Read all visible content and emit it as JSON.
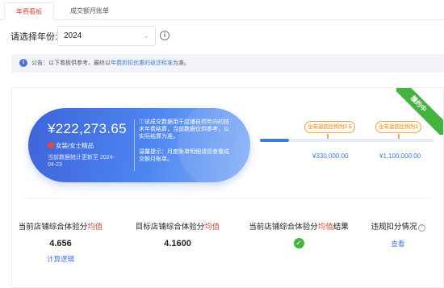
{
  "tabs": [
    {
      "label": "年费看板",
      "active": true
    },
    {
      "label": "成交额月账单",
      "active": false
    }
  ],
  "year_filter": {
    "label": "请选择年份:",
    "value": "2024"
  },
  "notice": {
    "prefix": "公告：以下看板供参考，最终以",
    "link": "年费折扣优惠的返还标准",
    "suffix": "为准。"
  },
  "status_ribbon": "履约中",
  "summary": {
    "amount": "¥222,273.65",
    "category": "女装/女士精品",
    "update_text": "当前数据统计更新至 2024-04-23",
    "explain": "该成交数据用于店铺自然年内的技术年费结算，当前数据仅供参考，以实际结算为准。",
    "tip": "温馨提示：月度账单明细请您查看成交额月账单。"
  },
  "progress": {
    "current": 222273.65,
    "max": 1100000,
    "milestones": [
      {
        "label": "全年返回比例为0.5",
        "value_text": "¥330,000.00"
      },
      {
        "label": "全年返回比例为1",
        "value_text": "¥1,100,000.00"
      }
    ]
  },
  "metrics": [
    {
      "title_prefix": "当前店铺综合体验分",
      "title_hl": "均值",
      "title_suffix": "",
      "value": "4.656",
      "link": "计算逻辑"
    },
    {
      "title_prefix": "目标店铺综合体验分",
      "title_hl": "均值",
      "title_suffix": "",
      "value": "4.1600"
    },
    {
      "title_prefix": "当前店铺综合体验分",
      "title_hl": "均值",
      "title_suffix": "结果",
      "status": "pass"
    },
    {
      "title_prefix": "违规扣分情况",
      "link": "查看"
    }
  ],
  "colors": {
    "accent_red": "#e5483e",
    "link_blue": "#3b7ae0",
    "success_green": "#43b43f",
    "milestone_orange": "#f0a64a"
  },
  "icons": {
    "info": "info-circle-icon",
    "chevron": "chevron-down-icon",
    "check": "check-circle-icon",
    "question": "question-circle-icon"
  }
}
